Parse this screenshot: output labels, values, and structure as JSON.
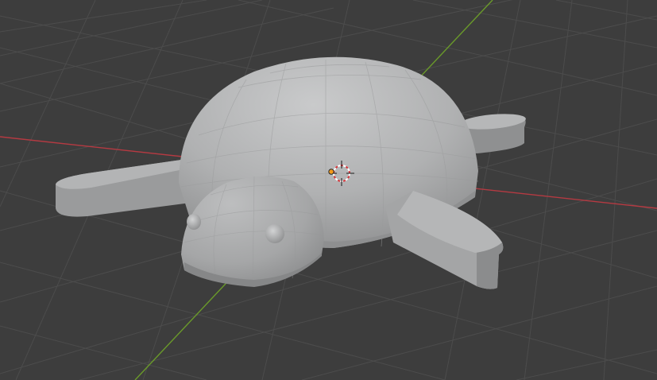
{
  "viewport": {
    "background": "#3d3d3d",
    "grid_color": "#4c4c4c",
    "x_axis_color": "#b53a42",
    "y_axis_color": "#6a9a2a",
    "object": {
      "name": "turtle",
      "shading": "solid",
      "base_color": "#9c9d9e",
      "highlight_color": "#c6c7c8"
    },
    "overlays": {
      "cursor_icon": "3d-cursor-icon",
      "origin_icon": "object-origin-icon",
      "origin_color": "#f29a1b"
    }
  }
}
